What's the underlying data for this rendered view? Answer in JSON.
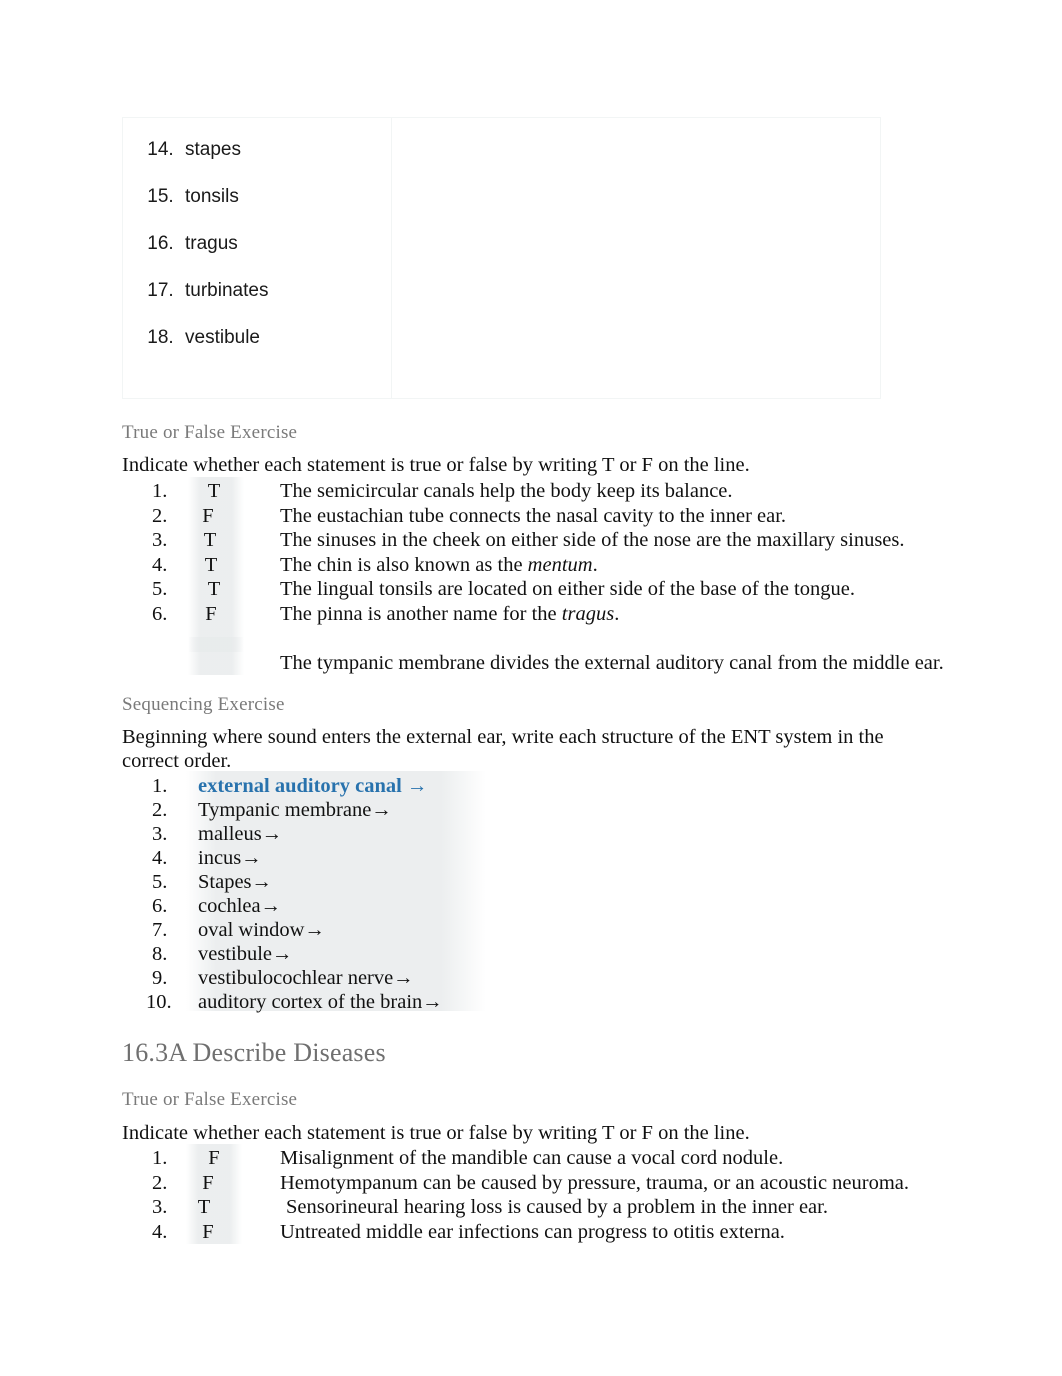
{
  "term_table": {
    "left_cell_items": [
      {
        "number": "14.",
        "label": "stapes"
      },
      {
        "number": "15.",
        "label": "tonsils"
      },
      {
        "number": "16.",
        "label": "tragus"
      },
      {
        "number": "17.",
        "label": "turbinates"
      },
      {
        "number": "18.",
        "label": "vestibule"
      }
    ],
    "right_cell_text": ""
  },
  "section_one": {
    "heading": "True or False Exercise",
    "instruction": "Indicate whether each statement is true or false by writing T or F on the line.",
    "items": [
      {
        "number": "1.",
        "answer": "T",
        "pre": "The semicircular canals help the body keep its balance.",
        "italic": "",
        "post": ""
      },
      {
        "number": "2.",
        "answer": "F",
        "pre": "The eustachian tube connects the nasal cavity to the inner ear.",
        "italic": "",
        "post": ""
      },
      {
        "number": "3.",
        "answer": "T",
        "pre": "The sinuses in the cheek on either side of the nose are the maxillary sinuses.",
        "italic": "",
        "post": ""
      },
      {
        "number": "4.",
        "answer": "T",
        "pre": "The chin is also known as the ",
        "italic": "mentum",
        "post": "."
      },
      {
        "number": "5.",
        "answer": "T",
        "pre": "The lingual tonsils are located on either side of the base of the tongue.",
        "italic": "",
        "post": ""
      },
      {
        "number": "6.",
        "answer": "F",
        "pre": "The pinna is another name for the ",
        "italic": "tragus",
        "post": "."
      },
      {
        "number": "",
        "answer": "",
        "pre": "The tympanic membrane divides the external auditory canal from the middle ear.",
        "italic": "",
        "post": ""
      }
    ]
  },
  "section_two": {
    "heading": "Sequencing Exercise",
    "instruction_line_1": "Beginning where sound enters the external ear, write each structure of the ENT system in the",
    "instruction_line_2": "correct order.",
    "items": [
      {
        "number": "1.",
        "label": "external auditory canal →",
        "style": "link"
      },
      {
        "number": "2.",
        "label": "Tympanic membrane→",
        "style": "plain"
      },
      {
        "number": "3.",
        "label": "malleus→",
        "style": "plain"
      },
      {
        "number": "4.",
        "label": "incus→",
        "style": "plain"
      },
      {
        "number": "5.",
        "label": "Stapes→",
        "style": "plain"
      },
      {
        "number": "6.",
        "label": "cochlea→",
        "style": "plain"
      },
      {
        "number": "7.",
        "label": "oval window→",
        "style": "plain"
      },
      {
        "number": "8.",
        "label": "vestibule→",
        "style": "plain"
      },
      {
        "number": "9.",
        "label": "vestibulocochlear nerve→",
        "style": "plain"
      },
      {
        "number": "10.",
        "label": "auditory cortex of the brain→",
        "style": "plain"
      }
    ]
  },
  "section_three": {
    "heading": "16.3A Describe Diseases",
    "sub_heading": "True or False Exercise",
    "instruction": "Indicate whether each statement is true or false by writing T or F on the line.",
    "items": [
      {
        "number": "1.",
        "answer": "F",
        "pre": "Misalignment of the mandible can cause a vocal cord nodule.",
        "italic": "",
        "post": ""
      },
      {
        "number": "2.",
        "answer": "F",
        "pre": "Hemotympanum can be caused by pressure, trauma, or an acoustic neuroma.",
        "italic": "",
        "post": ""
      },
      {
        "number": "3.",
        "answer": "T",
        "pre": "Sensorineural hearing loss is caused by a problem in the inner ear.",
        "italic": "",
        "post": ""
      },
      {
        "number": "4.",
        "answer": "F",
        "pre": "Untreated middle ear infections can progress to otitis externa.",
        "italic": "",
        "post": ""
      }
    ]
  },
  "colors": {
    "heading_gray": "#7a7a7a",
    "link_blue": "#2872ad",
    "body_black": "#101010",
    "table_border": "#f2f5f5",
    "field_shade": "#e8ebec"
  }
}
